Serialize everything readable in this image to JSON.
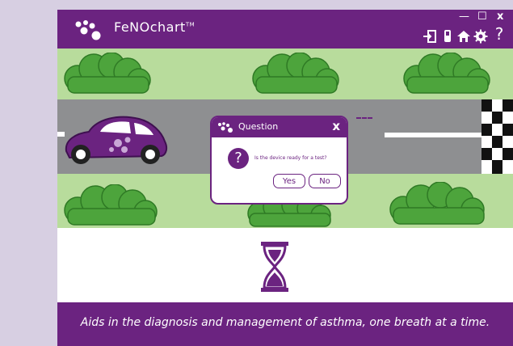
{
  "app": {
    "brand": "FeNOchart",
    "trademark": "TM"
  },
  "window_controls": {
    "minimize": "—",
    "maximize": "☐",
    "close": "x"
  },
  "toolbar": {
    "icons": [
      "logout-icon",
      "device-icon",
      "home-icon",
      "settings-icon",
      "help-icon"
    ],
    "help_glyph": "?"
  },
  "dialog": {
    "title": "Question",
    "close_label": "x",
    "icon_glyph": "?",
    "message": "Is the device ready for a test?",
    "yes_label": "Yes",
    "no_label": "No"
  },
  "footer": {
    "tagline": "Aids in the diagnosis and management of asthma, one breath at a time."
  },
  "colors": {
    "brand_purple": "#6b2380",
    "grass": "#b8dc9c",
    "road": "#8e8f91",
    "bush": "#4da43c"
  }
}
